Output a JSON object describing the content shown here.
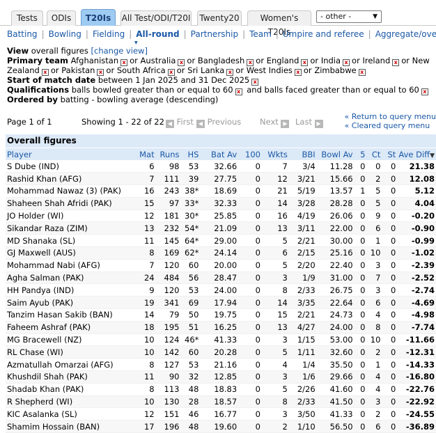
{
  "tabs": [
    "Tests",
    "ODIs",
    "T20Is",
    "All Test/ODI/T20I",
    "Twenty20",
    "Women's T20Is"
  ],
  "tab_select": "- other -",
  "subnav": [
    "Batting",
    "Bowling",
    "Fielding",
    "All-round",
    "Partnership",
    "Team",
    "Umpire and referee",
    "Aggregate/overall"
  ],
  "criteria": {
    "view_label": "View",
    "view_value": "overall figures",
    "change_view": "[change view]",
    "primary_team_label": "Primary team",
    "primary_teams": [
      "Afghanistan",
      "Australia",
      "Bangladesh",
      "England",
      "India",
      "Ireland",
      "New Zealand",
      "Pakistan",
      "South Africa",
      "Sri Lanka",
      "West Indies",
      "Zimbabwe"
    ],
    "or_word": "or",
    "start_label": "Start of match date",
    "start_value": "between 1 Jan 2025 and 31 Dec 2025",
    "qual_label": "Qualifications",
    "qual_1": "balls bowled greater than or equal to 60",
    "qual_and": "and",
    "qual_2": "balls faced greater than or equal to 60",
    "ordered_label": "Ordered by",
    "ordered_value": "batting - bowling average (descending)",
    "remove_icon": "close-icon"
  },
  "pager": {
    "page_text": "Page 1 of 1",
    "showing_text": "Showing 1 - 22 of 22",
    "first": "First",
    "previous": "Previous",
    "next": "Next",
    "last": "Last"
  },
  "return_links": [
    "Return to query menu",
    "Cleared query menu"
  ],
  "section_title": "Overall figures",
  "columns": [
    "Player",
    "Mat",
    "Runs",
    "HS",
    "Bat Av",
    "100",
    "Wkts",
    "BBI",
    "Bowl Av",
    "5",
    "Ct",
    "St",
    "Ave Diff"
  ],
  "rows": [
    [
      "S Dube (IND)",
      "6",
      "98",
      "53",
      "32.66",
      "0",
      "7",
      "3/4",
      "11.28",
      "0",
      "0",
      "0",
      "21.38"
    ],
    [
      "Rashid Khan (AFG)",
      "7",
      "111",
      "39",
      "27.75",
      "0",
      "12",
      "3/21",
      "15.66",
      "0",
      "2",
      "0",
      "12.08"
    ],
    [
      "Mohammad Nawaz (3) (PAK)",
      "16",
      "243",
      "38*",
      "18.69",
      "0",
      "21",
      "5/19",
      "13.57",
      "1",
      "5",
      "0",
      "5.12"
    ],
    [
      "Shaheen Shah Afridi (PAK)",
      "15",
      "97",
      "33*",
      "32.33",
      "0",
      "14",
      "3/28",
      "28.28",
      "0",
      "5",
      "0",
      "4.04"
    ],
    [
      "JO Holder (WI)",
      "12",
      "181",
      "30*",
      "25.85",
      "0",
      "16",
      "4/19",
      "26.06",
      "0",
      "9",
      "0",
      "-0.20"
    ],
    [
      "Sikandar Raza (ZIM)",
      "13",
      "232",
      "54*",
      "21.09",
      "0",
      "13",
      "3/11",
      "22.00",
      "0",
      "6",
      "0",
      "-0.90"
    ],
    [
      "MD Shanaka (SL)",
      "11",
      "145",
      "64*",
      "29.00",
      "0",
      "5",
      "2/21",
      "30.00",
      "0",
      "1",
      "0",
      "-0.99"
    ],
    [
      "GJ Maxwell (AUS)",
      "8",
      "169",
      "62*",
      "24.14",
      "0",
      "6",
      "2/15",
      "25.16",
      "0",
      "10",
      "0",
      "-1.02"
    ],
    [
      "Mohammad Nabi (AFG)",
      "7",
      "120",
      "60",
      "20.00",
      "0",
      "5",
      "2/20",
      "22.40",
      "0",
      "3",
      "0",
      "-2.39"
    ],
    [
      "Agha Salman (PAK)",
      "24",
      "484",
      "56",
      "28.47",
      "0",
      "3",
      "1/9",
      "31.00",
      "0",
      "7",
      "0",
      "-2.52"
    ],
    [
      "HH Pandya (IND)",
      "9",
      "120",
      "53",
      "24.00",
      "0",
      "8",
      "2/33",
      "26.75",
      "0",
      "3",
      "0",
      "-2.74"
    ],
    [
      "Saim Ayub (PAK)",
      "19",
      "341",
      "69",
      "17.94",
      "0",
      "14",
      "3/35",
      "22.64",
      "0",
      "6",
      "0",
      "-4.69"
    ],
    [
      "Tanzim Hasan Sakib (BAN)",
      "14",
      "79",
      "50",
      "19.75",
      "0",
      "15",
      "2/21",
      "24.73",
      "0",
      "4",
      "0",
      "-4.98"
    ],
    [
      "Faheem Ashraf (PAK)",
      "18",
      "195",
      "51",
      "16.25",
      "0",
      "13",
      "4/27",
      "24.00",
      "0",
      "8",
      "0",
      "-7.74"
    ],
    [
      "MG Bracewell (NZ)",
      "10",
      "124",
      "46*",
      "41.33",
      "0",
      "3",
      "1/15",
      "53.00",
      "0",
      "10",
      "0",
      "-11.66"
    ],
    [
      "RL Chase (WI)",
      "10",
      "142",
      "60",
      "20.28",
      "0",
      "5",
      "1/11",
      "32.60",
      "0",
      "2",
      "0",
      "-12.31"
    ],
    [
      "Azmatullah Omarzai (AFG)",
      "8",
      "127",
      "53",
      "21.16",
      "0",
      "4",
      "1/4",
      "35.50",
      "0",
      "1",
      "0",
      "-14.33"
    ],
    [
      "Khushdil Shah (PAK)",
      "11",
      "90",
      "32",
      "12.85",
      "0",
      "3",
      "1/6",
      "29.66",
      "0",
      "4",
      "0",
      "-16.80"
    ],
    [
      "Shadab Khan (PAK)",
      "8",
      "113",
      "48",
      "18.83",
      "0",
      "5",
      "2/26",
      "41.60",
      "0",
      "4",
      "0",
      "-22.76"
    ],
    [
      "R Shepherd (WI)",
      "10",
      "130",
      "28",
      "18.57",
      "0",
      "8",
      "2/33",
      "41.50",
      "0",
      "3",
      "0",
      "-22.92"
    ],
    [
      "KIC Asalanka (SL)",
      "12",
      "151",
      "46",
      "16.77",
      "0",
      "3",
      "3/50",
      "41.33",
      "0",
      "2",
      "0",
      "-24.55"
    ],
    [
      "Shamim Hossain (BAN)",
      "17",
      "196",
      "48",
      "19.60",
      "0",
      "2",
      "1/10",
      "56.50",
      "0",
      "6",
      "0",
      "-36.89"
    ]
  ]
}
